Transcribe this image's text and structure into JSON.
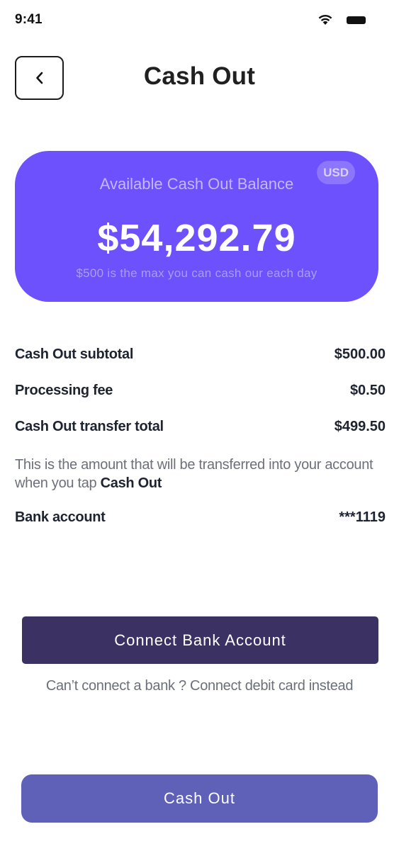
{
  "status_bar": {
    "time": "9:41",
    "icons": [
      "wifi-icon",
      "battery-icon"
    ]
  },
  "header": {
    "title": "Cash Out",
    "back_icon": "chevron-left-icon"
  },
  "balance_card": {
    "currency": "USD",
    "label": "Available Cash Out Balance",
    "amount": "$54,292.79",
    "note": "$500 is the max you can cash our each day",
    "color": "#6c51fd"
  },
  "summary": {
    "subtotal_label": "Cash Out subtotal",
    "subtotal_value": "$500.00",
    "fee_label": "Processing fee",
    "fee_value": "$0.50",
    "total_label": "Cash Out transfer total",
    "total_value": "$499.50",
    "explain_text": "This is the amount that will be transferred into your account when you tap",
    "explain_emphasis": "Cash Out",
    "bank_label": "Bank account",
    "bank_value": "***1119"
  },
  "actions": {
    "connect_bank_label": "Connect Bank Account",
    "alt_link_label": "Can’t connect a bank ? Connect debit card instead",
    "cash_out_label": "Cash Out",
    "connect_color": "#3b3162",
    "cash_out_color": "#5f60b8"
  }
}
